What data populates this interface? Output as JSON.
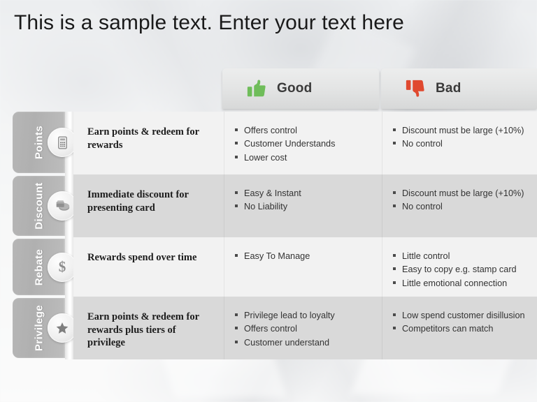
{
  "title": "This is a sample text. Enter your text here",
  "colors": {
    "good_accent": "#6fbd5a",
    "bad_accent": "#e0492f",
    "tab_gray": "#b4b4b4",
    "row_light": "#f2f2f2",
    "row_dark": "#d9d9d9"
  },
  "headers": {
    "good": {
      "label": "Good",
      "icon": "thumbs-up-icon"
    },
    "bad": {
      "label": "Bad",
      "icon": "thumbs-down-icon"
    }
  },
  "rows": [
    {
      "tab": "Points",
      "icon": "calculator-icon",
      "description": "Earn points  & redeem for rewards",
      "good": [
        "Offers control",
        "Customer Understands",
        "Lower cost"
      ],
      "bad": [
        "Discount must be large (+10%)",
        "No control"
      ]
    },
    {
      "tab": "Discount",
      "icon": "money-stack-icon",
      "description": "Immediate  discount for presenting card",
      "good": [
        "Easy & Instant",
        "No Liability"
      ],
      "bad": [
        "Discount  must be large (+10%)",
        "No control"
      ]
    },
    {
      "tab": "Rebate",
      "icon": "dollar-icon",
      "description": "Rewards spend over time",
      "good": [
        "Easy To Manage"
      ],
      "bad": [
        "Little control",
        "Easy to copy e.g. stamp card",
        "Little emotional connection"
      ]
    },
    {
      "tab": "Privilege",
      "icon": "star-icon",
      "description": "Earn points  & redeem for rewards plus  tiers of privilege",
      "good": [
        "Privilege lead to loyalty",
        "Offers control",
        "Customer understand"
      ],
      "bad": [
        "Low spend customer disillusion",
        "Competitors can match"
      ]
    }
  ]
}
